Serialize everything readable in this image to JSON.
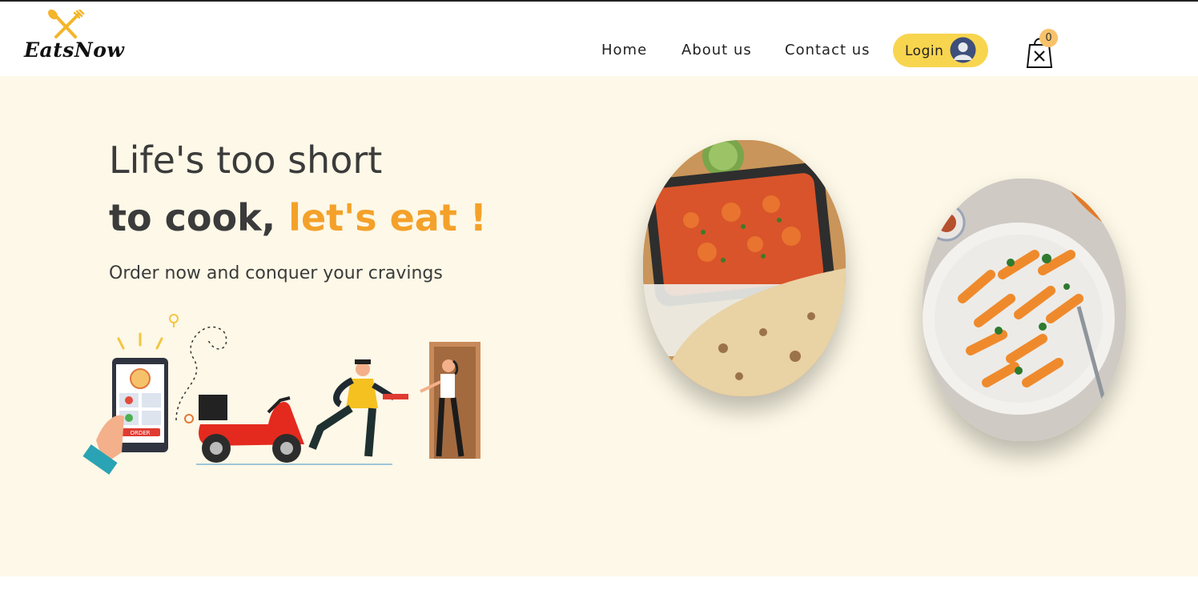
{
  "brand": {
    "name": "EatsNow"
  },
  "nav": {
    "items": [
      {
        "label": "Home"
      },
      {
        "label": "About us"
      },
      {
        "label": "Contact us"
      }
    ],
    "login_label": "Login"
  },
  "cart": {
    "count": "0"
  },
  "hero": {
    "headline_line1": "Life's too short",
    "headline_line2_prefix": "to cook, ",
    "headline_line2_accent": "let's eat !",
    "subheadline": "Order now and conquer your cravings",
    "illustration_order_label": "ORDER"
  },
  "colors": {
    "accent": "#f4a12a",
    "login_bg": "#f8d54f",
    "hero_bg": "#fdf8e7",
    "badge_bg": "#f8c26a"
  },
  "icons": {
    "logo": "fork-spoon-cross-icon",
    "avatar": "user-avatar-icon",
    "cart": "shopping-bag-icon"
  }
}
